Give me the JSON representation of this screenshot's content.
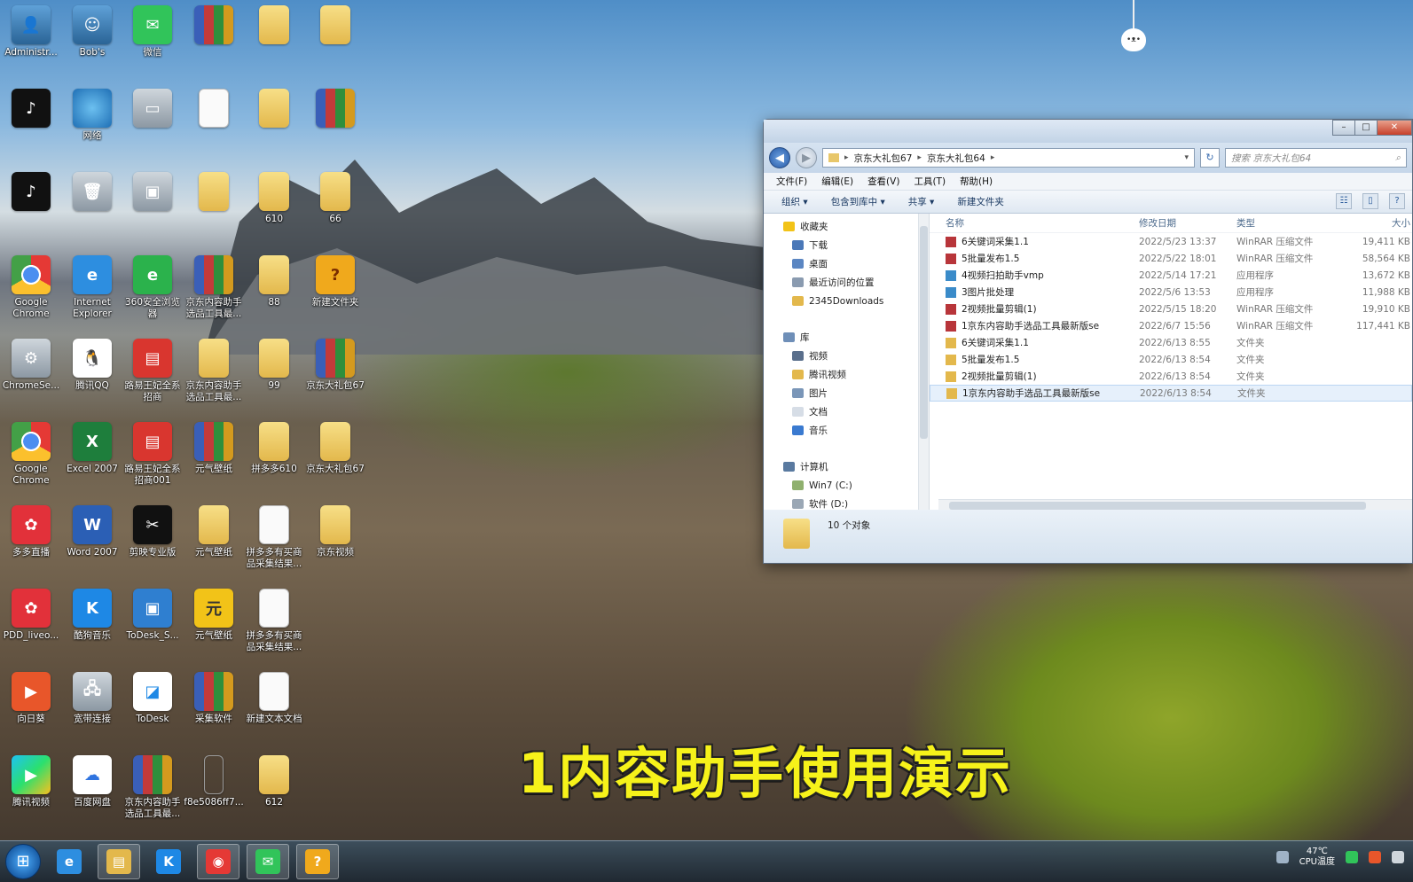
{
  "desktop": {
    "icons": [
      {
        "id": "i01",
        "label": "Administr...",
        "kind": "i-user",
        "glyph": "👤",
        "icon": "user-folder-icon"
      },
      {
        "id": "i02",
        "label": "Bob's",
        "kind": "i-user",
        "glyph": "☺",
        "icon": "user-icon"
      },
      {
        "id": "i03",
        "label": "微信",
        "kind": "i-wechat",
        "glyph": "✉",
        "icon": "wechat-icon"
      },
      {
        "id": "i04",
        "label": "",
        "kind": "i-rar",
        "glyph": "",
        "icon": "rar-archive-icon"
      },
      {
        "id": "i05",
        "label": "",
        "kind": "i-folder",
        "glyph": "",
        "icon": "folder-icon"
      },
      {
        "id": "i06",
        "label": "",
        "kind": "i-folder",
        "glyph": "",
        "icon": "folder-icon"
      },
      {
        "id": "i07",
        "label": "",
        "kind": "i-tiktok",
        "glyph": "♪",
        "icon": "tiktok-icon"
      },
      {
        "id": "i08",
        "label": "网络",
        "kind": "i-globe",
        "glyph": "",
        "icon": "network-icon"
      },
      {
        "id": "i09",
        "label": "",
        "kind": "i-gray",
        "glyph": "▭",
        "icon": "printer-icon"
      },
      {
        "id": "i10",
        "label": "",
        "kind": "i-doc",
        "glyph": "",
        "icon": "document-icon"
      },
      {
        "id": "i11",
        "label": "",
        "kind": "i-folder",
        "glyph": "",
        "icon": "folder-icon"
      },
      {
        "id": "i12",
        "label": "",
        "kind": "i-rar",
        "glyph": "",
        "icon": "rar-archive-icon"
      },
      {
        "id": "i13",
        "label": "",
        "kind": "i-tiktok",
        "glyph": "♪",
        "icon": "tiktok-icon"
      },
      {
        "id": "i14",
        "label": "",
        "kind": "i-gray",
        "glyph": "🗑",
        "icon": "recycle-bin-icon"
      },
      {
        "id": "i15",
        "label": "",
        "kind": "i-gray",
        "glyph": "▣",
        "icon": "scanner-icon"
      },
      {
        "id": "i16",
        "label": "",
        "kind": "i-folder",
        "glyph": "",
        "icon": "folder-icon"
      },
      {
        "id": "i17",
        "label": "610",
        "kind": "i-folder",
        "glyph": "",
        "icon": "folder-icon"
      },
      {
        "id": "i18",
        "label": "66",
        "kind": "i-folder",
        "glyph": "",
        "icon": "folder-icon"
      },
      {
        "id": "i19",
        "label": "Google Chrome",
        "kind": "i-chrome",
        "glyph": "",
        "icon": "chrome-icon"
      },
      {
        "id": "i20",
        "label": "Internet Explorer",
        "kind": "i-ie",
        "glyph": "e",
        "icon": "internet-explorer-icon"
      },
      {
        "id": "i21",
        "label": "360安全浏览器",
        "kind": "i-green",
        "glyph": "e",
        "icon": "360-browser-icon"
      },
      {
        "id": "i22",
        "label": "京东内容助手选品工具最...",
        "kind": "i-rar",
        "glyph": "",
        "icon": "rar-archive-icon"
      },
      {
        "id": "i23",
        "label": "88",
        "kind": "i-folder",
        "glyph": "",
        "icon": "folder-icon"
      },
      {
        "id": "i24",
        "label": "新建文件夹",
        "kind": "i-help",
        "glyph": "?",
        "icon": "help-file-icon"
      },
      {
        "id": "i25",
        "label": "ChromeSe...",
        "kind": "i-gray",
        "glyph": "⚙",
        "icon": "chrome-setup-icon"
      },
      {
        "id": "i26",
        "label": "腾讯QQ",
        "kind": "i-qq",
        "glyph": "🐧",
        "icon": "qq-icon"
      },
      {
        "id": "i27",
        "label": "路易王妃全系招商",
        "kind": "i-red",
        "glyph": "▤",
        "icon": "spreadsheet-red-icon"
      },
      {
        "id": "i28",
        "label": "京东内容助手选品工具最...",
        "kind": "i-folder",
        "glyph": "",
        "icon": "folder-icon"
      },
      {
        "id": "i29",
        "label": "99",
        "kind": "i-folder",
        "glyph": "",
        "icon": "folder-icon"
      },
      {
        "id": "i30",
        "label": "京东大礼包67",
        "kind": "i-rar",
        "glyph": "",
        "icon": "rar-archive-icon"
      },
      {
        "id": "i31",
        "label": "Google Chrome",
        "kind": "i-chrome",
        "glyph": "",
        "icon": "chrome-icon"
      },
      {
        "id": "i32",
        "label": "Excel 2007",
        "kind": "i-excel",
        "glyph": "X",
        "icon": "excel-icon"
      },
      {
        "id": "i33",
        "label": "路易王妃全系招商001",
        "kind": "i-red",
        "glyph": "▤",
        "icon": "spreadsheet-red-icon"
      },
      {
        "id": "i34",
        "label": "元气壁纸",
        "kind": "i-rar",
        "glyph": "",
        "icon": "rar-archive-icon"
      },
      {
        "id": "i35",
        "label": "拼多多610",
        "kind": "i-folder",
        "glyph": "",
        "icon": "folder-icon"
      },
      {
        "id": "i36",
        "label": "京东大礼包67",
        "kind": "i-folder",
        "glyph": "",
        "icon": "folder-icon"
      },
      {
        "id": "i37",
        "label": "多多直播",
        "kind": "i-pdd",
        "glyph": "✿",
        "icon": "pinduoduo-live-icon"
      },
      {
        "id": "i38",
        "label": "Word 2007",
        "kind": "i-word",
        "glyph": "W",
        "icon": "word-icon"
      },
      {
        "id": "i39",
        "label": "剪映专业版",
        "kind": "i-black",
        "glyph": "✂",
        "icon": "jianying-icon"
      },
      {
        "id": "i40",
        "label": "元气壁纸",
        "kind": "i-folder",
        "glyph": "",
        "icon": "folder-icon"
      },
      {
        "id": "i41",
        "label": "拼多多有买商品采集结果...",
        "kind": "i-doc",
        "glyph": "",
        "icon": "document-icon"
      },
      {
        "id": "i42",
        "label": "京东视频",
        "kind": "i-folder",
        "glyph": "",
        "icon": "folder-icon"
      },
      {
        "id": "i43",
        "label": "PDD_liveo...",
        "kind": "i-pdd",
        "glyph": "✿",
        "icon": "pdd-live-icon"
      },
      {
        "id": "i44",
        "label": "酷狗音乐",
        "kind": "i-blue-k",
        "glyph": "K",
        "icon": "kugou-icon"
      },
      {
        "id": "i45",
        "label": "ToDesk_S...",
        "kind": "i-box",
        "glyph": "▣",
        "icon": "todesk-setup-icon"
      },
      {
        "id": "i46",
        "label": "元气壁纸",
        "kind": "i-yuan",
        "glyph": "元",
        "icon": "yuanqi-wallpaper-icon"
      },
      {
        "id": "i47",
        "label": "拼多多有买商品采集结果...",
        "kind": "i-doc",
        "glyph": "",
        "icon": "document-icon"
      },
      {
        "id": "i48",
        "label": "向日葵",
        "kind": "i-orange",
        "glyph": "▶",
        "icon": "sunlogin-icon"
      },
      {
        "id": "i49",
        "label": "宽带连接",
        "kind": "i-gray",
        "glyph": "🖧",
        "icon": "broadband-icon"
      },
      {
        "id": "i50",
        "label": "ToDesk",
        "kind": "i-todesk",
        "glyph": "◪",
        "icon": "todesk-icon"
      },
      {
        "id": "i51",
        "label": "采集软件",
        "kind": "i-rar",
        "glyph": "",
        "icon": "rar-archive-icon"
      },
      {
        "id": "i52",
        "label": "新建文本文档",
        "kind": "i-doc",
        "glyph": "",
        "icon": "text-document-icon"
      },
      {
        "id": "i53",
        "label": "腾讯视频",
        "kind": "i-video",
        "glyph": "▶",
        "icon": "tencent-video-icon"
      },
      {
        "id": "i54",
        "label": "百度网盘",
        "kind": "i-baidu",
        "glyph": "☁",
        "icon": "baidu-netdisk-icon"
      },
      {
        "id": "i55",
        "label": "京东内容助手选品工具最...",
        "kind": "i-rar",
        "glyph": "",
        "icon": "rar-archive-icon"
      },
      {
        "id": "i56",
        "label": "f8e5086ff7...",
        "kind": "i-phone",
        "glyph": "",
        "icon": "phone-file-icon"
      },
      {
        "id": "i57",
        "label": "612",
        "kind": "i-folder",
        "glyph": "",
        "icon": "folder-icon"
      }
    ]
  },
  "explorer": {
    "address": {
      "segments": [
        "京东大礼包67",
        "京东大礼包64"
      ]
    },
    "search_placeholder": "搜索 京东大礼包64",
    "menu": [
      "文件(F)",
      "编辑(E)",
      "查看(V)",
      "工具(T)",
      "帮助(H)"
    ],
    "toolbar": {
      "organize": "组织 ▾",
      "include": "包含到库中 ▾",
      "share": "共享 ▾",
      "new_folder": "新建文件夹"
    },
    "nav": {
      "favorites": "收藏夹",
      "fav_items": [
        "下载",
        "桌面",
        "最近访问的位置",
        "2345Downloads"
      ],
      "libraries": "库",
      "lib_items": [
        "视频",
        "腾讯视频",
        "图片",
        "文档",
        "音乐"
      ],
      "computer": "计算机",
      "comp_items": [
        "Win7 (C:)",
        "软件 (D:)"
      ]
    },
    "columns": {
      "name": "名称",
      "date": "修改日期",
      "type": "类型",
      "size": "大小"
    },
    "files": [
      {
        "name": "6关键词采集1.1",
        "date": "2022/5/23 13:37",
        "type": "WinRAR 压缩文件",
        "size": "19,411 KB",
        "icon": "rar"
      },
      {
        "name": "5批量发布1.5",
        "date": "2022/5/22 18:01",
        "type": "WinRAR 压缩文件",
        "size": "58,564 KB",
        "icon": "rar"
      },
      {
        "name": "4视频扫拍助手vmp",
        "date": "2022/5/14 17:21",
        "type": "应用程序",
        "size": "13,672 KB",
        "icon": "app"
      },
      {
        "name": "3图片批处理",
        "date": "2022/5/6 13:53",
        "type": "应用程序",
        "size": "11,988 KB",
        "icon": "app"
      },
      {
        "name": "2视频批量剪辑(1)",
        "date": "2022/5/15 18:20",
        "type": "WinRAR 压缩文件",
        "size": "19,910 KB",
        "icon": "rar"
      },
      {
        "name": "1京东内容助手选品工具最新版se",
        "date": "2022/6/7 15:56",
        "type": "WinRAR 压缩文件",
        "size": "117,441 KB",
        "icon": "rar"
      },
      {
        "name": "6关键词采集1.1",
        "date": "2022/6/13 8:55",
        "type": "文件夹",
        "size": "",
        "icon": "folder"
      },
      {
        "name": "5批量发布1.5",
        "date": "2022/6/13 8:54",
        "type": "文件夹",
        "size": "",
        "icon": "folder"
      },
      {
        "name": "2视频批量剪辑(1)",
        "date": "2022/6/13 8:54",
        "type": "文件夹",
        "size": "",
        "icon": "folder"
      },
      {
        "name": "1京东内容助手选品工具最新版se",
        "date": "2022/6/13 8:54",
        "type": "文件夹",
        "size": "",
        "icon": "folder",
        "selected": true
      }
    ],
    "status_count": "10 个对象"
  },
  "caption": "1内容助手使用演示",
  "taskbar": {
    "apps": [
      {
        "glyph": "e",
        "icon": "ie-taskbar-icon",
        "bg": "#2d8ee0"
      },
      {
        "glyph": "▤",
        "icon": "explorer-taskbar-icon",
        "bg": "#e3b84c",
        "active": true
      },
      {
        "glyph": "K",
        "icon": "kugou-taskbar-icon",
        "bg": "#1e88e5"
      },
      {
        "glyph": "◉",
        "icon": "chrome-taskbar-icon",
        "bg": "#e53935",
        "active": true
      },
      {
        "glyph": "✉",
        "icon": "wechat-taskbar-icon",
        "bg": "#31c45a",
        "active": true
      },
      {
        "glyph": "?",
        "icon": "help-taskbar-icon",
        "bg": "#f0a91c",
        "active": true
      }
    ],
    "tray": {
      "temp": "47℃",
      "temp_label": "CPU温度"
    }
  },
  "colors": {
    "caption": "#f6f21a",
    "accent": "#2458a7"
  }
}
